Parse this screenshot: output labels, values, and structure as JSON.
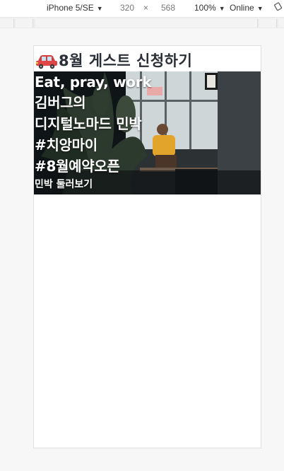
{
  "devtools": {
    "device": "iPhone 5/SE",
    "width": "320",
    "times": "×",
    "height": "568",
    "zoom": "100%",
    "network": "Online"
  },
  "page": {
    "title": "8월 게스트 신청하기",
    "title_icon": "car-icon",
    "hero": {
      "lines": [
        "Eat, pray, work",
        "김버그의",
        "디지털노마드 민박",
        "#치앙마이",
        "#8월예약오픈"
      ],
      "link": "민박 둘러보기"
    }
  }
}
